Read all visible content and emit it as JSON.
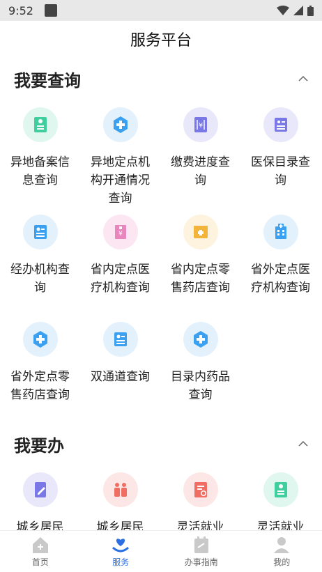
{
  "status": {
    "time": "9:52"
  },
  "page_title": "服务平台",
  "sections": [
    {
      "title": "我要查询",
      "items": [
        {
          "label": "异地备案信息查询",
          "icon": "id-card-icon",
          "bg": "#dff7ef",
          "fg": "#3fcf9f"
        },
        {
          "label": "异地定点机构开通情况查询",
          "icon": "medical-cross-icon",
          "bg": "#e3f1fd",
          "fg": "#3aa0ef"
        },
        {
          "label": "缴费进度查询",
          "icon": "payment-doc-icon",
          "bg": "#e9e8fb",
          "fg": "#7a78e6"
        },
        {
          "label": "医保目录查询",
          "icon": "list-card-icon",
          "bg": "#e9e8fb",
          "fg": "#7a78e6"
        },
        {
          "label": "经办机构查询",
          "icon": "person-card-icon",
          "bg": "#e3f1fd",
          "fg": "#3aa0ef"
        },
        {
          "label": "省内定点医疗机构查询",
          "icon": "hospital-building-icon",
          "bg": "#fbe6f2",
          "fg": "#e986bd"
        },
        {
          "label": "省内定点零售药店查询",
          "icon": "pharmacy-icon",
          "bg": "#fdf3de",
          "fg": "#f3b43b"
        },
        {
          "label": "省外定点医疗机构查询",
          "icon": "hospital-icon",
          "bg": "#e3f1fd",
          "fg": "#3aa0ef"
        },
        {
          "label": "省外定点零售药店查询",
          "icon": "medical-cross-icon",
          "bg": "#e3f1fd",
          "fg": "#3aa0ef"
        },
        {
          "label": "双通道查询",
          "icon": "person-card-icon",
          "bg": "#e3f1fd",
          "fg": "#3aa0ef"
        },
        {
          "label": "目录内药品查询",
          "icon": "medical-cross-icon",
          "bg": "#e3f1fd",
          "fg": "#3aa0ef"
        }
      ]
    },
    {
      "title": "我要办",
      "items": [
        {
          "label": "城乡居民",
          "icon": "edit-doc-icon",
          "bg": "#e9e8fb",
          "fg": "#7a78e6"
        },
        {
          "label": "城乡居民",
          "icon": "family-icon",
          "bg": "#fde7e6",
          "fg": "#ef6d62"
        },
        {
          "label": "灵活就业",
          "icon": "certificate-icon",
          "bg": "#fde7e6",
          "fg": "#ef6d62"
        },
        {
          "label": "灵活就业",
          "icon": "id-card-icon",
          "bg": "#dff7ef",
          "fg": "#3fcf9f"
        }
      ]
    }
  ],
  "tabs": [
    {
      "label": "首页",
      "icon": "home-icon",
      "active": false
    },
    {
      "label": "服务",
      "icon": "heart-hand-icon",
      "active": true
    },
    {
      "label": "办事指南",
      "icon": "calendar-icon",
      "active": false
    },
    {
      "label": "我的",
      "icon": "profile-icon",
      "active": false
    }
  ],
  "colors": {
    "accent": "#2a6fe3",
    "tab_inactive": "#c9c9c9"
  }
}
